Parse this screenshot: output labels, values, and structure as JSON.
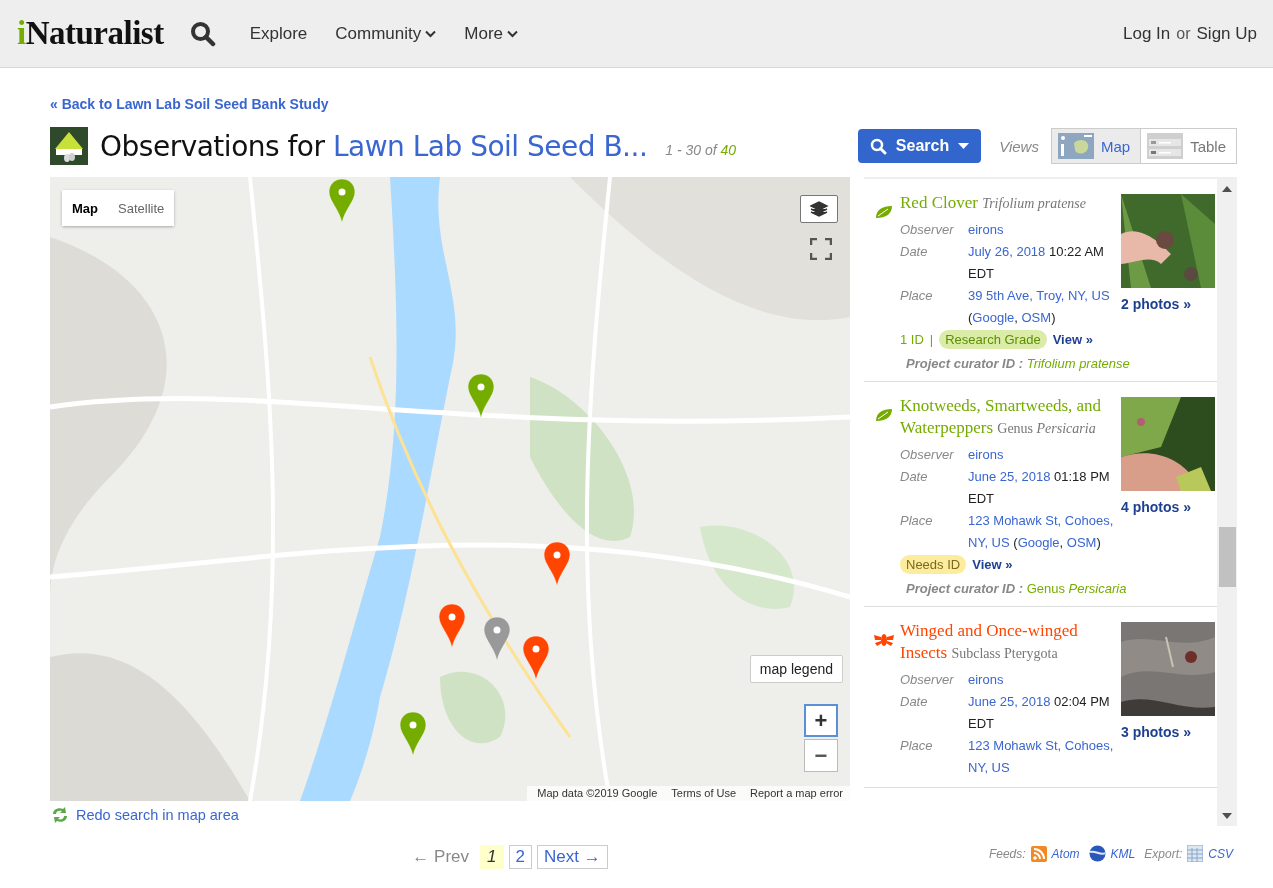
{
  "header": {
    "logo": "iNaturalist",
    "nav": [
      {
        "label": "Explore",
        "dropdown": false
      },
      {
        "label": "Community",
        "dropdown": true
      },
      {
        "label": "More",
        "dropdown": true
      }
    ],
    "login": "Log In",
    "or": "or",
    "signup": "Sign Up"
  },
  "back_link": "« Back to Lawn Lab Soil Seed Bank Study",
  "title": {
    "prefix": "Observations for",
    "project": "Lawn Lab Soil Seed B...",
    "range": "1 - 30 of",
    "total": "40"
  },
  "search_button": "Search",
  "views": {
    "label": "Views",
    "options": [
      {
        "kind": "map",
        "label": "Map",
        "selected": true
      },
      {
        "kind": "table",
        "label": "Table",
        "selected": false
      }
    ]
  },
  "map": {
    "types": [
      {
        "label": "Map",
        "selected": true
      },
      {
        "label": "Satellite",
        "selected": false
      }
    ],
    "legend": "map legend",
    "zoom_in": "+",
    "zoom_out": "−",
    "attribution": [
      "Map data ©2019 Google",
      "Terms of Use",
      "Report a map error"
    ],
    "markers": [
      {
        "color": "#74ac00"
      },
      {
        "color": "#74ac00"
      },
      {
        "color": "#ff4500"
      },
      {
        "color": "#ff4500"
      },
      {
        "color": "#999999"
      },
      {
        "color": "#ff4500"
      },
      {
        "color": "#74ac00"
      }
    ]
  },
  "redo_link": "Redo search in map area",
  "observations": [
    {
      "kind": "plant",
      "common": "Red Clover",
      "taxon": {
        "name": "Trifolium pratense",
        "italic": true
      },
      "rows": [
        {
          "label": "Observer",
          "parts": [
            {
              "text": "eirons",
              "link": true
            }
          ]
        },
        {
          "label": "Date",
          "parts": [
            {
              "text": "July 26, 2018",
              "link": true
            },
            {
              "text": " 10:22 AM EDT",
              "link": false
            }
          ]
        },
        {
          "label": "Place",
          "parts": [
            {
              "text": "39 5th Ave, Troy, NY, US",
              "link": true
            },
            {
              "text": " (",
              "link": false
            },
            {
              "text": "Google",
              "link": true
            },
            {
              "text": ", ",
              "link": false
            },
            {
              "text": "OSM",
              "link": true
            },
            {
              "text": ")",
              "link": false
            }
          ]
        }
      ],
      "ids": "1 ID",
      "ids_separator": "|",
      "quality": {
        "kind": "research",
        "label": "Research Grade"
      },
      "view": "View »",
      "curator_label": "Project curator ID :",
      "curator_taxon": {
        "name": "Trifolium pratense",
        "italic": true
      },
      "photos": "2 photos »"
    },
    {
      "kind": "plant",
      "common": "Knotweeds, Smartweeds, and Waterpeppers",
      "taxon": {
        "rank": "Genus",
        "name": "Persicaria",
        "italic": true
      },
      "rows": [
        {
          "label": "Observer",
          "parts": [
            {
              "text": "eirons",
              "link": true
            }
          ]
        },
        {
          "label": "Date",
          "parts": [
            {
              "text": "June 25, 2018",
              "link": true
            },
            {
              "text": " 01:18 PM EDT",
              "link": false
            }
          ]
        },
        {
          "label": "Place",
          "parts": [
            {
              "text": "123 Mohawk St, Cohoes, NY, US",
              "link": true
            },
            {
              "text": " (",
              "link": false
            },
            {
              "text": "Google",
              "link": true
            },
            {
              "text": ", ",
              "link": false
            },
            {
              "text": "OSM",
              "link": true
            },
            {
              "text": ")",
              "link": false
            }
          ]
        }
      ],
      "quality": {
        "kind": "needs_id",
        "label": "Needs ID"
      },
      "view": "View »",
      "curator_label": "Project curator ID :",
      "curator_taxon": {
        "rank": "Genus",
        "name": "Persicaria",
        "italic": true
      },
      "photos": "4 photos »"
    },
    {
      "kind": "insect",
      "common": "Winged and Once-winged Insects",
      "taxon": {
        "rank": "Subclass",
        "name": "Pterygota",
        "italic": false
      },
      "rows": [
        {
          "label": "Observer",
          "parts": [
            {
              "text": "eirons",
              "link": true
            }
          ]
        },
        {
          "label": "Date",
          "parts": [
            {
              "text": "June 25, 2018",
              "link": true
            },
            {
              "text": " 02:04 PM EDT",
              "link": false
            }
          ]
        },
        {
          "label": "Place",
          "parts": [
            {
              "text": "123 Mohawk St, Cohoes, NY, US",
              "link": true
            }
          ]
        }
      ],
      "photos": "3 photos »"
    }
  ],
  "pagination": {
    "prev": "← Prev",
    "prev_disabled": true,
    "pages": [
      {
        "label": "1",
        "selected": true
      },
      {
        "label": "2",
        "selected": false
      }
    ],
    "next": "Next →"
  },
  "feeds": {
    "feeds_label": "Feeds:",
    "atom": "Atom",
    "kml": "KML",
    "export_label": "Export:",
    "csv": "CSV"
  }
}
